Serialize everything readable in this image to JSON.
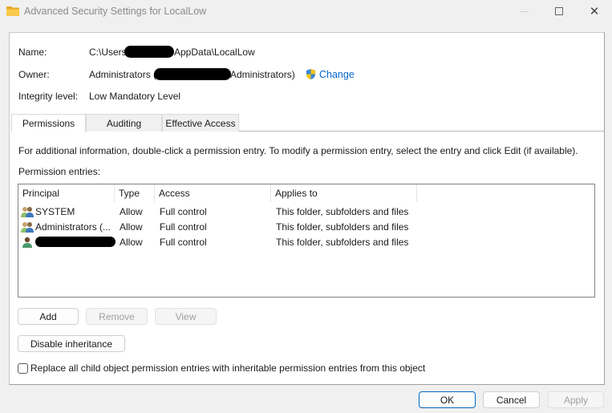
{
  "window": {
    "title": "Advanced Security Settings for LocalLow",
    "icon": "folder-icon",
    "controls": {
      "minimize": "minimize-icon",
      "maximize": "maximize-icon",
      "close": "close-icon",
      "close_glyph": "✕"
    }
  },
  "info": {
    "name_label": "Name:",
    "name_prefix": "C:\\Users",
    "name_suffix": "AppData\\LocalLow",
    "owner_label": "Owner:",
    "owner_prefix": "Administrators (",
    "owner_suffix": "Administrators)",
    "change_link": "Change",
    "change_icon": "uac-shield-icon",
    "integrity_label": "Integrity level:",
    "integrity_value": "Low Mandatory Level"
  },
  "tabs": [
    {
      "label": "Permissions",
      "active": true
    },
    {
      "label": "Auditing",
      "active": false
    },
    {
      "label": "Effective Access",
      "active": false
    }
  ],
  "permissions": {
    "hint": "For additional information, double-click a permission entry. To modify a permission entry, select the entry and click Edit (if available).",
    "entries_label": "Permission entries:",
    "columns": [
      "Principal",
      "Type",
      "Access",
      "Applies to"
    ],
    "rows": [
      {
        "principal": "SYSTEM",
        "icon": "group-users-icon",
        "type": "Allow",
        "access": "Full control",
        "applies_to": "This folder, subfolders and files"
      },
      {
        "principal": "Administrators (...",
        "icon": "group-users-icon",
        "type": "Allow",
        "access": "Full control",
        "applies_to": "This folder, subfolders and files"
      },
      {
        "principal": "",
        "icon": "user-icon",
        "redacted": true,
        "type": "Allow",
        "access": "Full control",
        "applies_to": "This folder, subfolders and files"
      }
    ],
    "buttons": {
      "add": "Add",
      "remove": "Remove",
      "view": "View"
    },
    "disable_inheritance": "Disable inheritance",
    "replace_checkbox": {
      "label": "Replace all child object permission entries with inheritable permission entries from this object",
      "checked": false
    }
  },
  "footer": {
    "ok": "OK",
    "cancel": "Cancel",
    "apply": "Apply"
  },
  "colors": {
    "link": "#0066cc",
    "primary_border": "#0067c0",
    "folder": "#f5c242"
  }
}
